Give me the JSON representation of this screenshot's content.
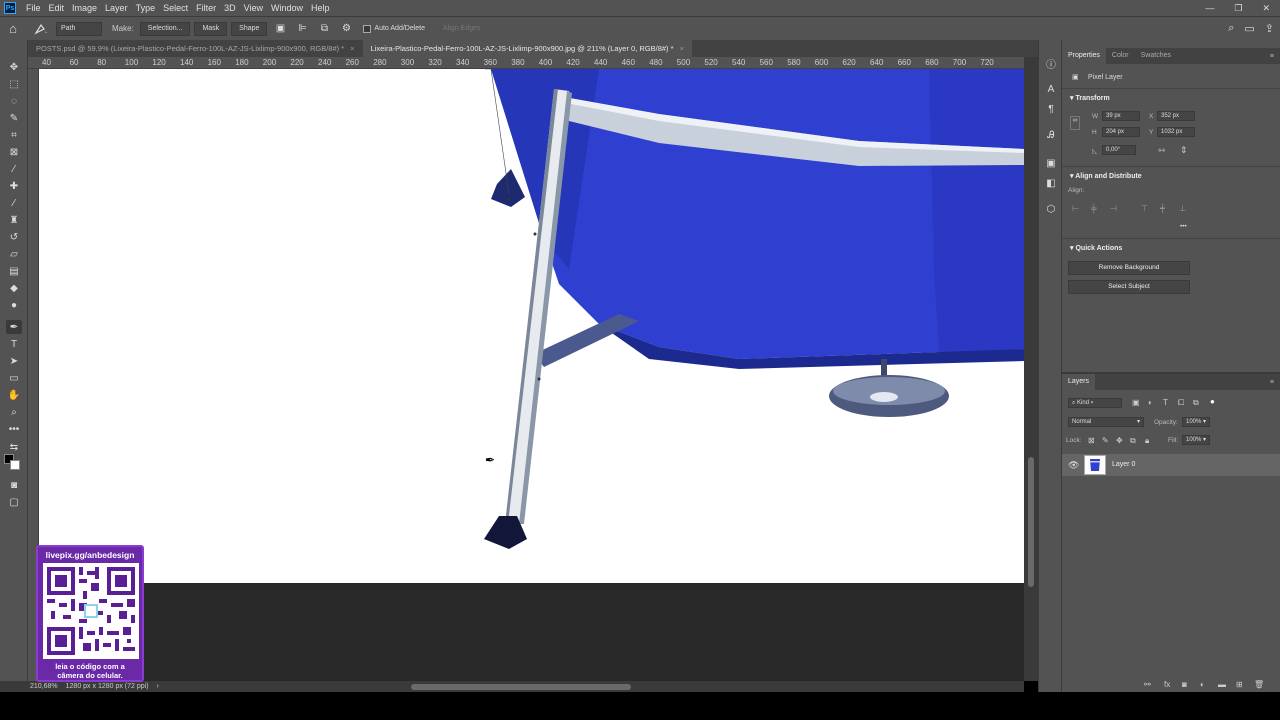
{
  "menu": {
    "items": [
      "File",
      "Edit",
      "Image",
      "Layer",
      "Type",
      "Select",
      "Filter",
      "3D",
      "View",
      "Window",
      "Help"
    ]
  },
  "options": {
    "mode": "Path",
    "make_label": "Make:",
    "selection_btn": "Selection...",
    "mask_btn": "Mask",
    "shape_btn": "Shape",
    "auto_add_delete": "Auto Add/Delete",
    "align_edges": "Align Edges"
  },
  "tabs": [
    {
      "label": "POSTS.psd @ 59,9% (Lixeira-Plastico-Pedal-Ferro-100L-AZ-JS-Lixlimp-900x900, RGB/8#) *",
      "close": "×"
    },
    {
      "label": "Lixeira-Plastico-Pedal-Ferro-100L-AZ-JS-Lixlimp-900x900.jpg @ 211% (Layer 0, RGB/8#) *",
      "close": "×"
    }
  ],
  "ruler": {
    "top_ticks": [
      "40",
      "60",
      "80",
      "100",
      "120",
      "140",
      "160",
      "180",
      "200",
      "220",
      "240",
      "260",
      "280",
      "300",
      "320",
      "340",
      "360",
      "380",
      "400",
      "420",
      "440",
      "460",
      "480",
      "500",
      "520",
      "540",
      "560",
      "580",
      "600",
      "620",
      "640",
      "660",
      "680",
      "700",
      "720"
    ]
  },
  "status": {
    "zoom": "210,68%",
    "doc_info": "1280 px x 1280 px (72 ppi)"
  },
  "properties": {
    "tabs": [
      "Properties",
      "Color",
      "Swatches"
    ],
    "layer_type": "Pixel Layer",
    "transform_title": "Transform",
    "w_label": "W",
    "w_value": "39 px",
    "h_label": "H",
    "h_value": "204 px",
    "x_label": "X",
    "x_value": "352 px",
    "y_label": "Y",
    "y_value": "1032 px",
    "angle_value": "0,00°",
    "align_title": "Align and Distribute",
    "align_label": "Align:",
    "more": "•••",
    "quick_title": "Quick Actions",
    "remove_bg": "Remove Background",
    "select_subject": "Select Subject"
  },
  "layers": {
    "title": "Layers",
    "kind": "Kind",
    "blend_mode": "Normal",
    "opacity_label": "Opacity:",
    "opacity_value": "100%",
    "lock_label": "Lock:",
    "fill_label": "Fill:",
    "fill_value": "100%",
    "layer_name": "Layer 0"
  },
  "overlay": {
    "url": "livepix.gg/anbedesign",
    "caption_line1": "leia o código com a",
    "caption_line2": "câmera do celular."
  },
  "colors": {
    "chrome": "#535353",
    "dark": "#424242",
    "bin_blue": "#2f3fd0",
    "overlay_purple": "#6a2aa7"
  }
}
